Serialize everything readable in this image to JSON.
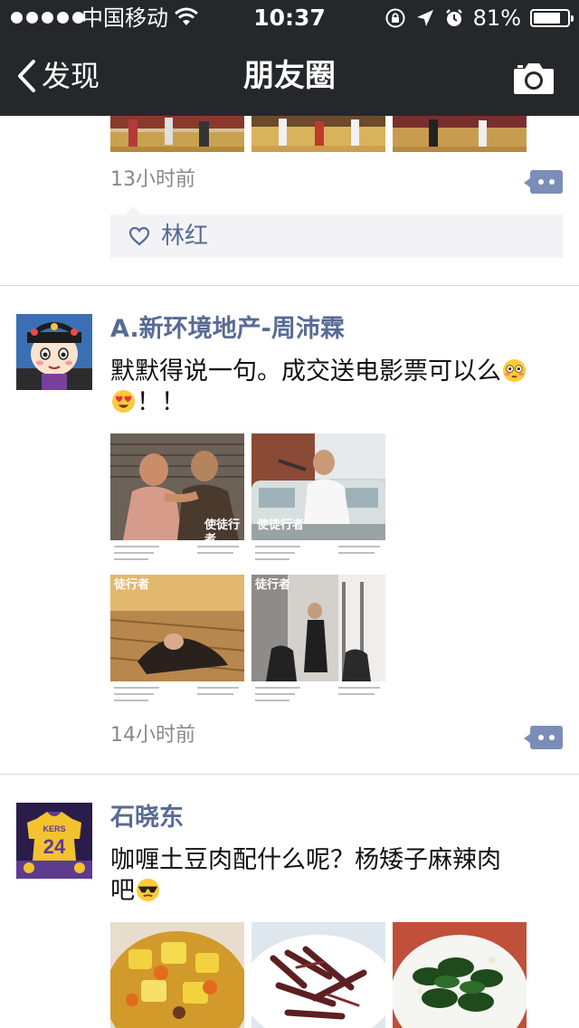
{
  "status_bar": {
    "carrier": "中国移动",
    "time": "10:37",
    "battery_percent": "81%",
    "battery_level": 0.81
  },
  "nav": {
    "back_label": "发现",
    "title": "朋友圈"
  },
  "posts": [
    {
      "time": "13小时前",
      "likes": [
        "林红"
      ]
    },
    {
      "author": "A.新环境地产-周沛霖",
      "text_line1": "默默得说一句。成交送电影票可以么",
      "text_line2": "！！",
      "time": "14小时前",
      "image_watermarks": [
        "使徒行者",
        "使徒行者",
        "徒行者",
        "徒行者"
      ]
    },
    {
      "author": "石晓东",
      "text_line1": "咖喱土豆肉配什么呢？杨矮子麻辣肉",
      "text_line2": "吧",
      "avatar_jersey_number": "24"
    }
  ],
  "icons": {
    "back": "chevron-left-icon",
    "camera": "camera-icon",
    "comment": "comment-dots-icon",
    "like": "heart-outline-icon",
    "wifi": "wifi-icon",
    "lock": "rotation-lock-icon",
    "location": "location-arrow-icon",
    "alarm": "alarm-clock-icon",
    "battery": "battery-icon"
  },
  "colors": {
    "nav_background": "#26272b",
    "link_blue": "#576b95",
    "comment_button": "#7b8db8",
    "timestamp_gray": "#888888"
  }
}
